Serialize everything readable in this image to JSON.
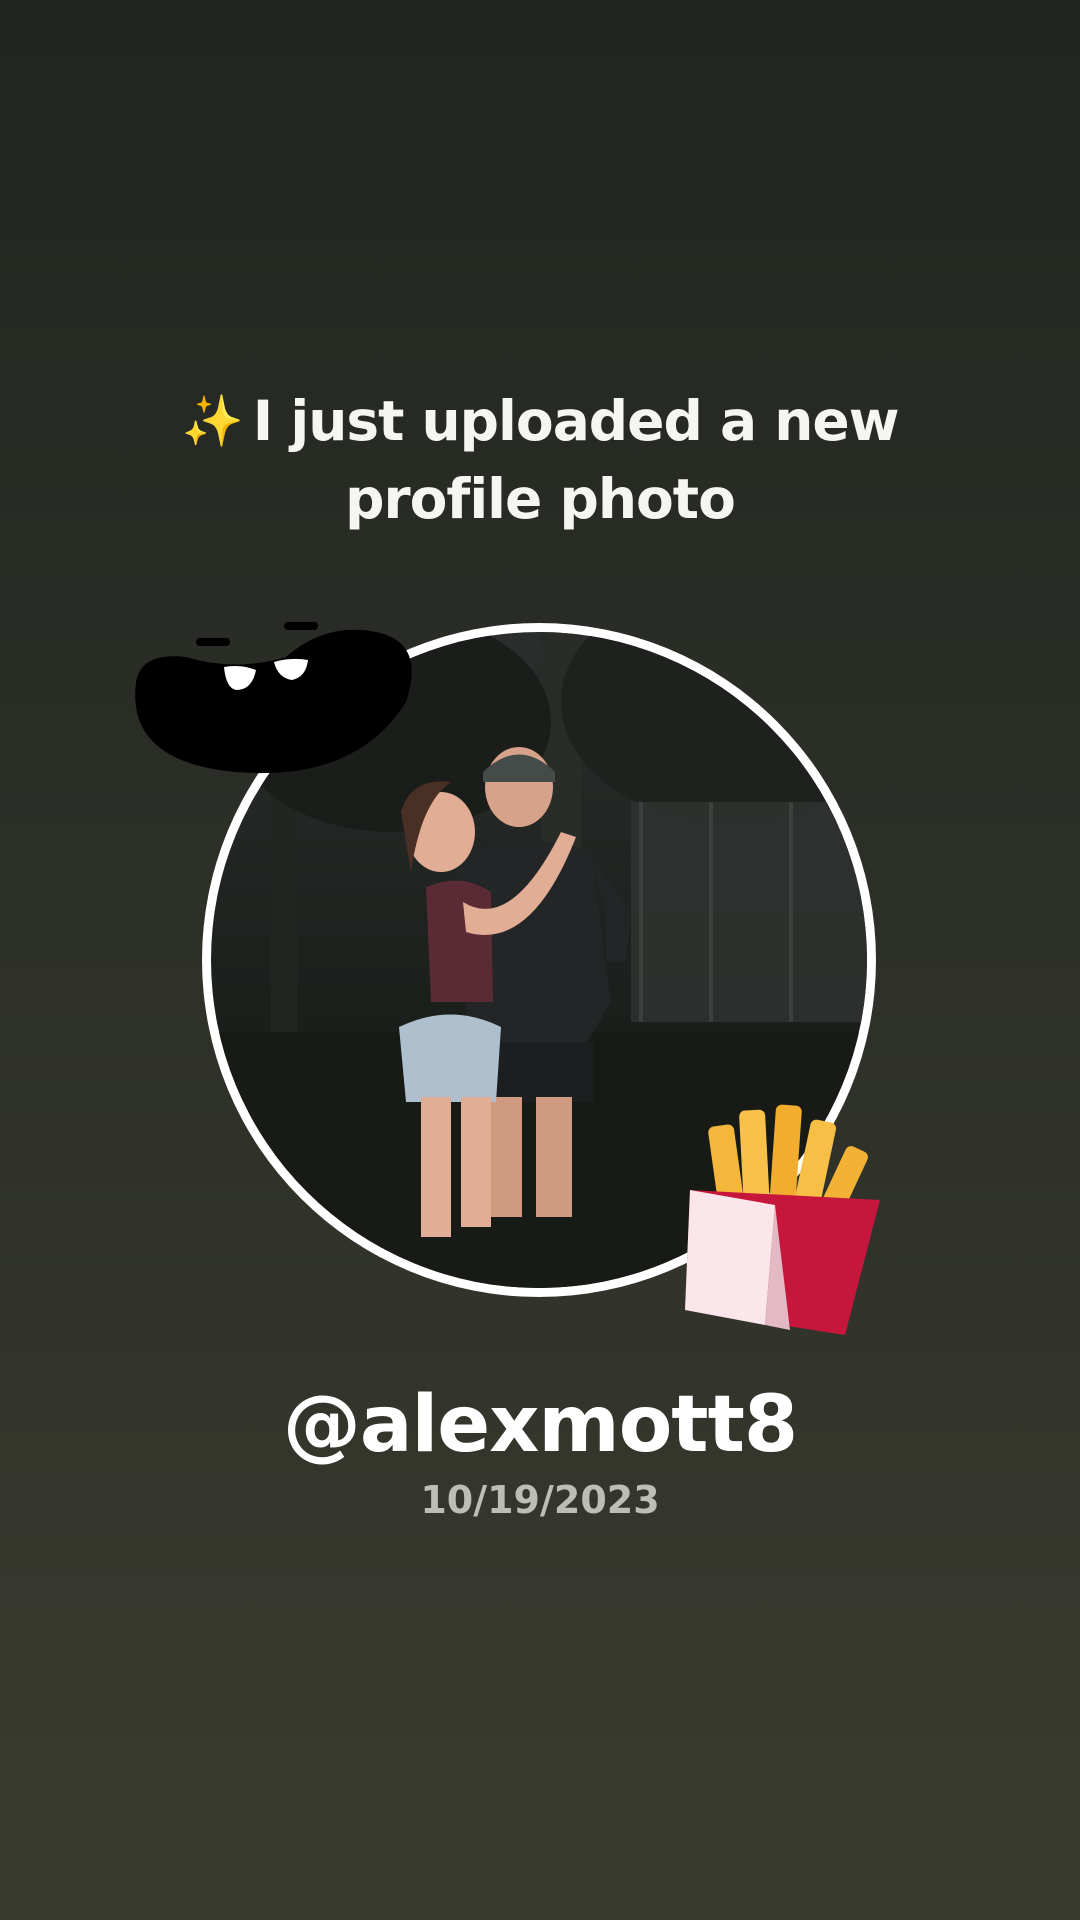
{
  "headline": {
    "sparkle_icon": "sparkles-icon",
    "line1": "I just uploaded a new",
    "line2": "profile photo"
  },
  "profile": {
    "username": "@alexmott8",
    "date": "10/19/2023"
  },
  "stickers": {
    "top_left": "black-blob-face-sticker",
    "bottom_right": "french-fries-sticker"
  },
  "colors": {
    "background_top": "#222620",
    "background_bottom": "#3a3b30",
    "text": "#ffffff",
    "date_text": "#bdbcb6",
    "ring": "#ffffff"
  }
}
